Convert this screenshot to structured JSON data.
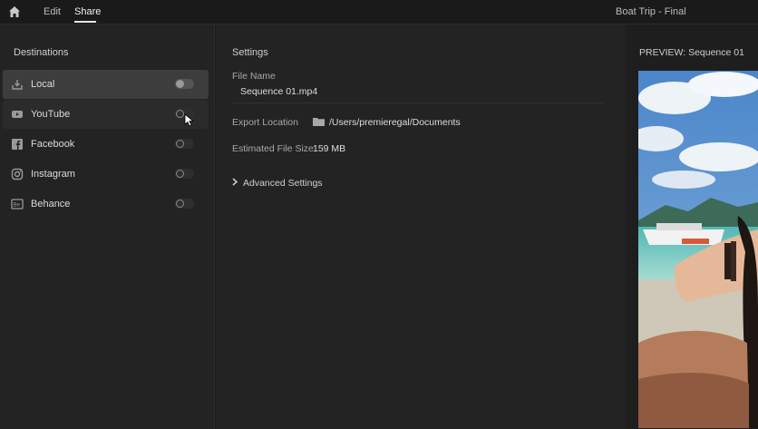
{
  "nav": {
    "edit_label": "Edit",
    "share_label": "Share",
    "doc_title": "Boat Trip - Final"
  },
  "destinations": {
    "title": "Destinations",
    "items": [
      {
        "label": "Local",
        "icon": "download-icon",
        "enabled": false,
        "selected": true
      },
      {
        "label": "YouTube",
        "icon": "youtube-icon",
        "enabled": false
      },
      {
        "label": "Facebook",
        "icon": "facebook-icon",
        "enabled": false
      },
      {
        "label": "Instagram",
        "icon": "instagram-icon",
        "enabled": false
      },
      {
        "label": "Behance",
        "icon": "behance-icon",
        "enabled": false
      }
    ]
  },
  "settings": {
    "title": "Settings",
    "file_name_label": "File Name",
    "file_name_value": "Sequence 01.mp4",
    "export_location_label": "Export Location",
    "export_location_value": "/Users/premieregal/Documents",
    "file_size_label": "Estimated File Size",
    "file_size_value": "159 MB",
    "advanced_label": "Advanced Settings"
  },
  "preview": {
    "title": "PREVIEW: Sequence 01"
  }
}
